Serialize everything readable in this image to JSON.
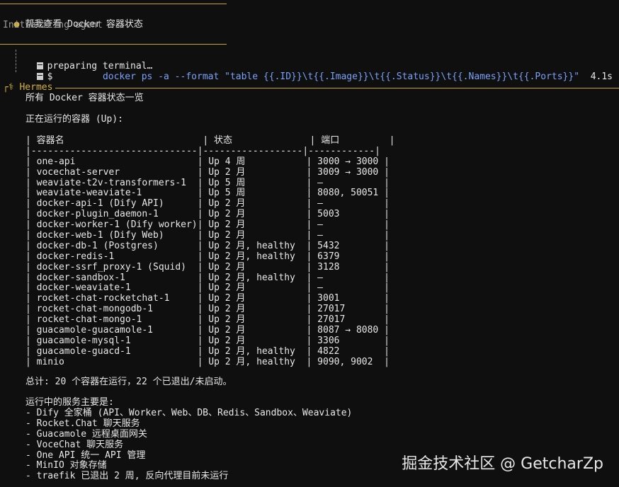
{
  "prompt": {
    "bullet": "●",
    "text": "帮我查看 Docker 容器状态",
    "status": "Initializing agent ..."
  },
  "tool": {
    "line1": "preparing terminal…",
    "line2_prefix": "$",
    "command": "docker ps -a --format \"table {{.ID}}\\t{{.Image}}\\t{{.Status}}\\t{{.Names}}\\t{{.Ports}}\"",
    "duration": "4.1s"
  },
  "hermes": {
    "label": "⚕ Hermes"
  },
  "response": {
    "title": "所有 Docker 容器状态一览",
    "running_heading": "正在运行的容器 (Up):",
    "table_header": "| 容器名                         | 状态              | 端口         |",
    "table_sep": "|------------------------------|------------------|------------|",
    "rows": [
      "| one-api                      | Up 4 周           | 3000 → 3000 |",
      "| vocechat-server              | Up 2 月           | 3009 → 3000 |",
      "| weaviate-t2v-transformers-1  | Up 5 周           | —           |",
      "| weaviate-weaviate-1          | Up 5 周           | 8080, 50051 |",
      "| docker-api-1 (Dify API)      | Up 2 月           | —           |",
      "| docker-plugin_daemon-1       | Up 2 月           | 5003        |",
      "| docker-worker-1 (Dify worker)| Up 2 月           | —           |",
      "| docker-web-1 (Dify Web)      | Up 2 月           | —           |",
      "| docker-db-1 (Postgres)       | Up 2 月, healthy  | 5432        |",
      "| docker-redis-1               | Up 2 月, healthy  | 6379        |",
      "| docker-ssrf_proxy-1 (Squid)  | Up 2 月           | 3128        |",
      "| docker-sandbox-1             | Up 2 月, healthy  | —           |",
      "| docker-weaviate-1            | Up 2 月           | —           |",
      "| rocket-chat-rocketchat-1     | Up 2 月           | 3001        |",
      "| rocket-chat-mongodb-1        | Up 2 月           | 27017       |",
      "| rocket-chat-mongo-1          | Up 2 月           | 27017       |",
      "| guacamole-guacamole-1        | Up 2 月           | 8087 → 8080 |",
      "| guacamole-mysql-1            | Up 2 月           | 3306        |",
      "| guacamole-guacd-1            | Up 2 月, healthy  | 4822        |",
      "| minio                        | Up 2 月, healthy  | 9090, 9002  |"
    ],
    "summary": "总计: 20 个容器在运行，22 个已退出/未启动。",
    "services_heading": "运行中的服务主要是:",
    "services": [
      "- Dify 全家桶 (API、Worker、Web、DB、Redis、Sandbox、Weaviate)",
      "- Rocket.Chat 聊天服务",
      "- Guacamole 远程桌面网关",
      "- VoceChat 聊天服务",
      "- One API 统一 API 管理",
      "- MinIO 对象存储",
      "- traefik 已退出 2 周, 反向代理目前未运行"
    ]
  },
  "watermark": "掘金技术社区 @ GetcharZp"
}
